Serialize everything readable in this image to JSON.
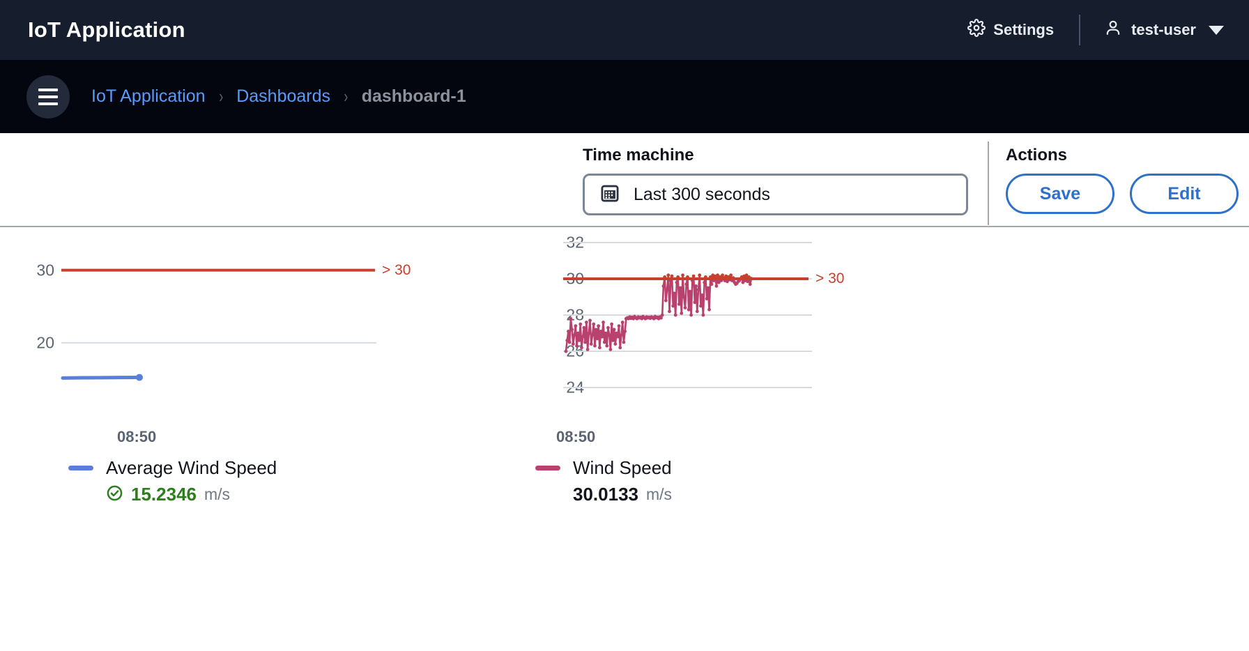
{
  "header": {
    "app_title": "IoT Application",
    "settings_label": "Settings",
    "settings_icon": "gear-icon",
    "user_name": "test-user",
    "user_icon": "person-icon",
    "caret_icon": "chevron-down-icon"
  },
  "breadcrumb": {
    "menu_icon": "hamburger-menu-icon",
    "items": [
      {
        "label": "IoT Application",
        "current": false
      },
      {
        "label": "Dashboards",
        "current": false
      },
      {
        "label": "dashboard-1",
        "current": true
      }
    ],
    "separator": "›"
  },
  "toolbar": {
    "time_machine_label": "Time machine",
    "time_range_value": "Last 300 seconds",
    "calendar_icon": "calendar-icon",
    "actions_label": "Actions",
    "save_label": "Save",
    "edit_label": "Edit"
  },
  "colors": {
    "accent_blue": "#2f70c8",
    "series_blue": "#5a7fdb",
    "series_crimson": "#b8416e",
    "threshold_red": "#c8402c",
    "status_green": "#2e7d1e",
    "header_bg": "#161d2d",
    "crumb_bg": "#03060e"
  },
  "chart_data": [
    {
      "id": "average-wind-speed",
      "type": "line",
      "title": "Average Wind Speed",
      "xlabel": "",
      "ylabel": "",
      "unit": "m/s",
      "ylim": [
        10,
        34
      ],
      "yticks": [
        30,
        20
      ],
      "xticks": [
        "08:50"
      ],
      "grid": true,
      "legend_position": "bottom-left",
      "latest_value": "15.2346",
      "status_icon": "check-circle-icon",
      "status_ok": true,
      "threshold": {
        "value": 30,
        "label": "> 30",
        "color": "#c8402c"
      },
      "series": [
        {
          "name": "Average Wind Speed",
          "color": "#5a7fdb",
          "x": [
            0,
            0.25,
            0.5,
            0.75,
            1.0
          ],
          "values": [
            15.15,
            15.18,
            15.2,
            15.22,
            15.2346
          ]
        }
      ]
    },
    {
      "id": "wind-speed",
      "type": "line",
      "title": "Wind Speed",
      "xlabel": "",
      "ylabel": "",
      "unit": "m/s",
      "ylim": [
        24,
        32
      ],
      "yticks": [
        32,
        30,
        28,
        26,
        24
      ],
      "xticks": [
        "08:50"
      ],
      "grid": true,
      "legend_position": "bottom-left",
      "latest_value": "30.0133",
      "status_icon": null,
      "status_ok": false,
      "threshold": {
        "value": 30,
        "label": "> 30",
        "color": "#c8402c"
      },
      "series": [
        {
          "name": "Wind Speed",
          "color": "#b8416e",
          "over_threshold_color": "#c8402c",
          "values": [
            26.0,
            26.6,
            27.1,
            26.5,
            27.8,
            27.2,
            26.4,
            26.9,
            27.4,
            26.3,
            27.0,
            26.6,
            27.5,
            26.2,
            26.8,
            27.3,
            26.5,
            27.6,
            26.1,
            27.0,
            27.7,
            26.4,
            26.9,
            27.5,
            26.3,
            27.2,
            26.7,
            27.4,
            26.2,
            27.1,
            26.8,
            27.6,
            26.5,
            27.0,
            26.3,
            27.3,
            26.9,
            26.1,
            27.5,
            26.6,
            27.2,
            26.4,
            27.0,
            26.8,
            27.4,
            26.2,
            26.9,
            27.6,
            26.5,
            27.1,
            27.8,
            27.85,
            27.8,
            27.9,
            27.82,
            27.88,
            27.8,
            27.92,
            27.85,
            27.8,
            27.9,
            27.84,
            27.88,
            27.8,
            27.92,
            27.86,
            27.8,
            27.9,
            27.84,
            27.88,
            27.82,
            27.9,
            27.86,
            27.8,
            27.92,
            27.85,
            27.88,
            27.8,
            27.9,
            27.84,
            28.0,
            29.6,
            30.1,
            28.8,
            29.4,
            30.2,
            28.2,
            29.9,
            30.15,
            28.5,
            29.2,
            28.0,
            29.8,
            30.1,
            28.6,
            29.5,
            28.1,
            30.2,
            29.0,
            28.4,
            29.7,
            30.1,
            28.3,
            29.3,
            28.0,
            29.9,
            30.15,
            28.7,
            29.6,
            28.2,
            29.4,
            30.2,
            28.5,
            29.1,
            28.0,
            29.8,
            30.1,
            28.9,
            29.5,
            28.3,
            30.1,
            29.7,
            30.2,
            29.9,
            30.15,
            29.6,
            30.2,
            29.8,
            30.1,
            29.9,
            30.2,
            30.05,
            29.9,
            30.15,
            29.85,
            30.1,
            29.95,
            30.2,
            29.9,
            30.05,
            29.8,
            29.7,
            29.75,
            29.85,
            29.9,
            30.0,
            30.1,
            29.8,
            30.15,
            29.9,
            30.2,
            29.85,
            30.1,
            29.7,
            30.0133
          ]
        }
      ]
    }
  ]
}
